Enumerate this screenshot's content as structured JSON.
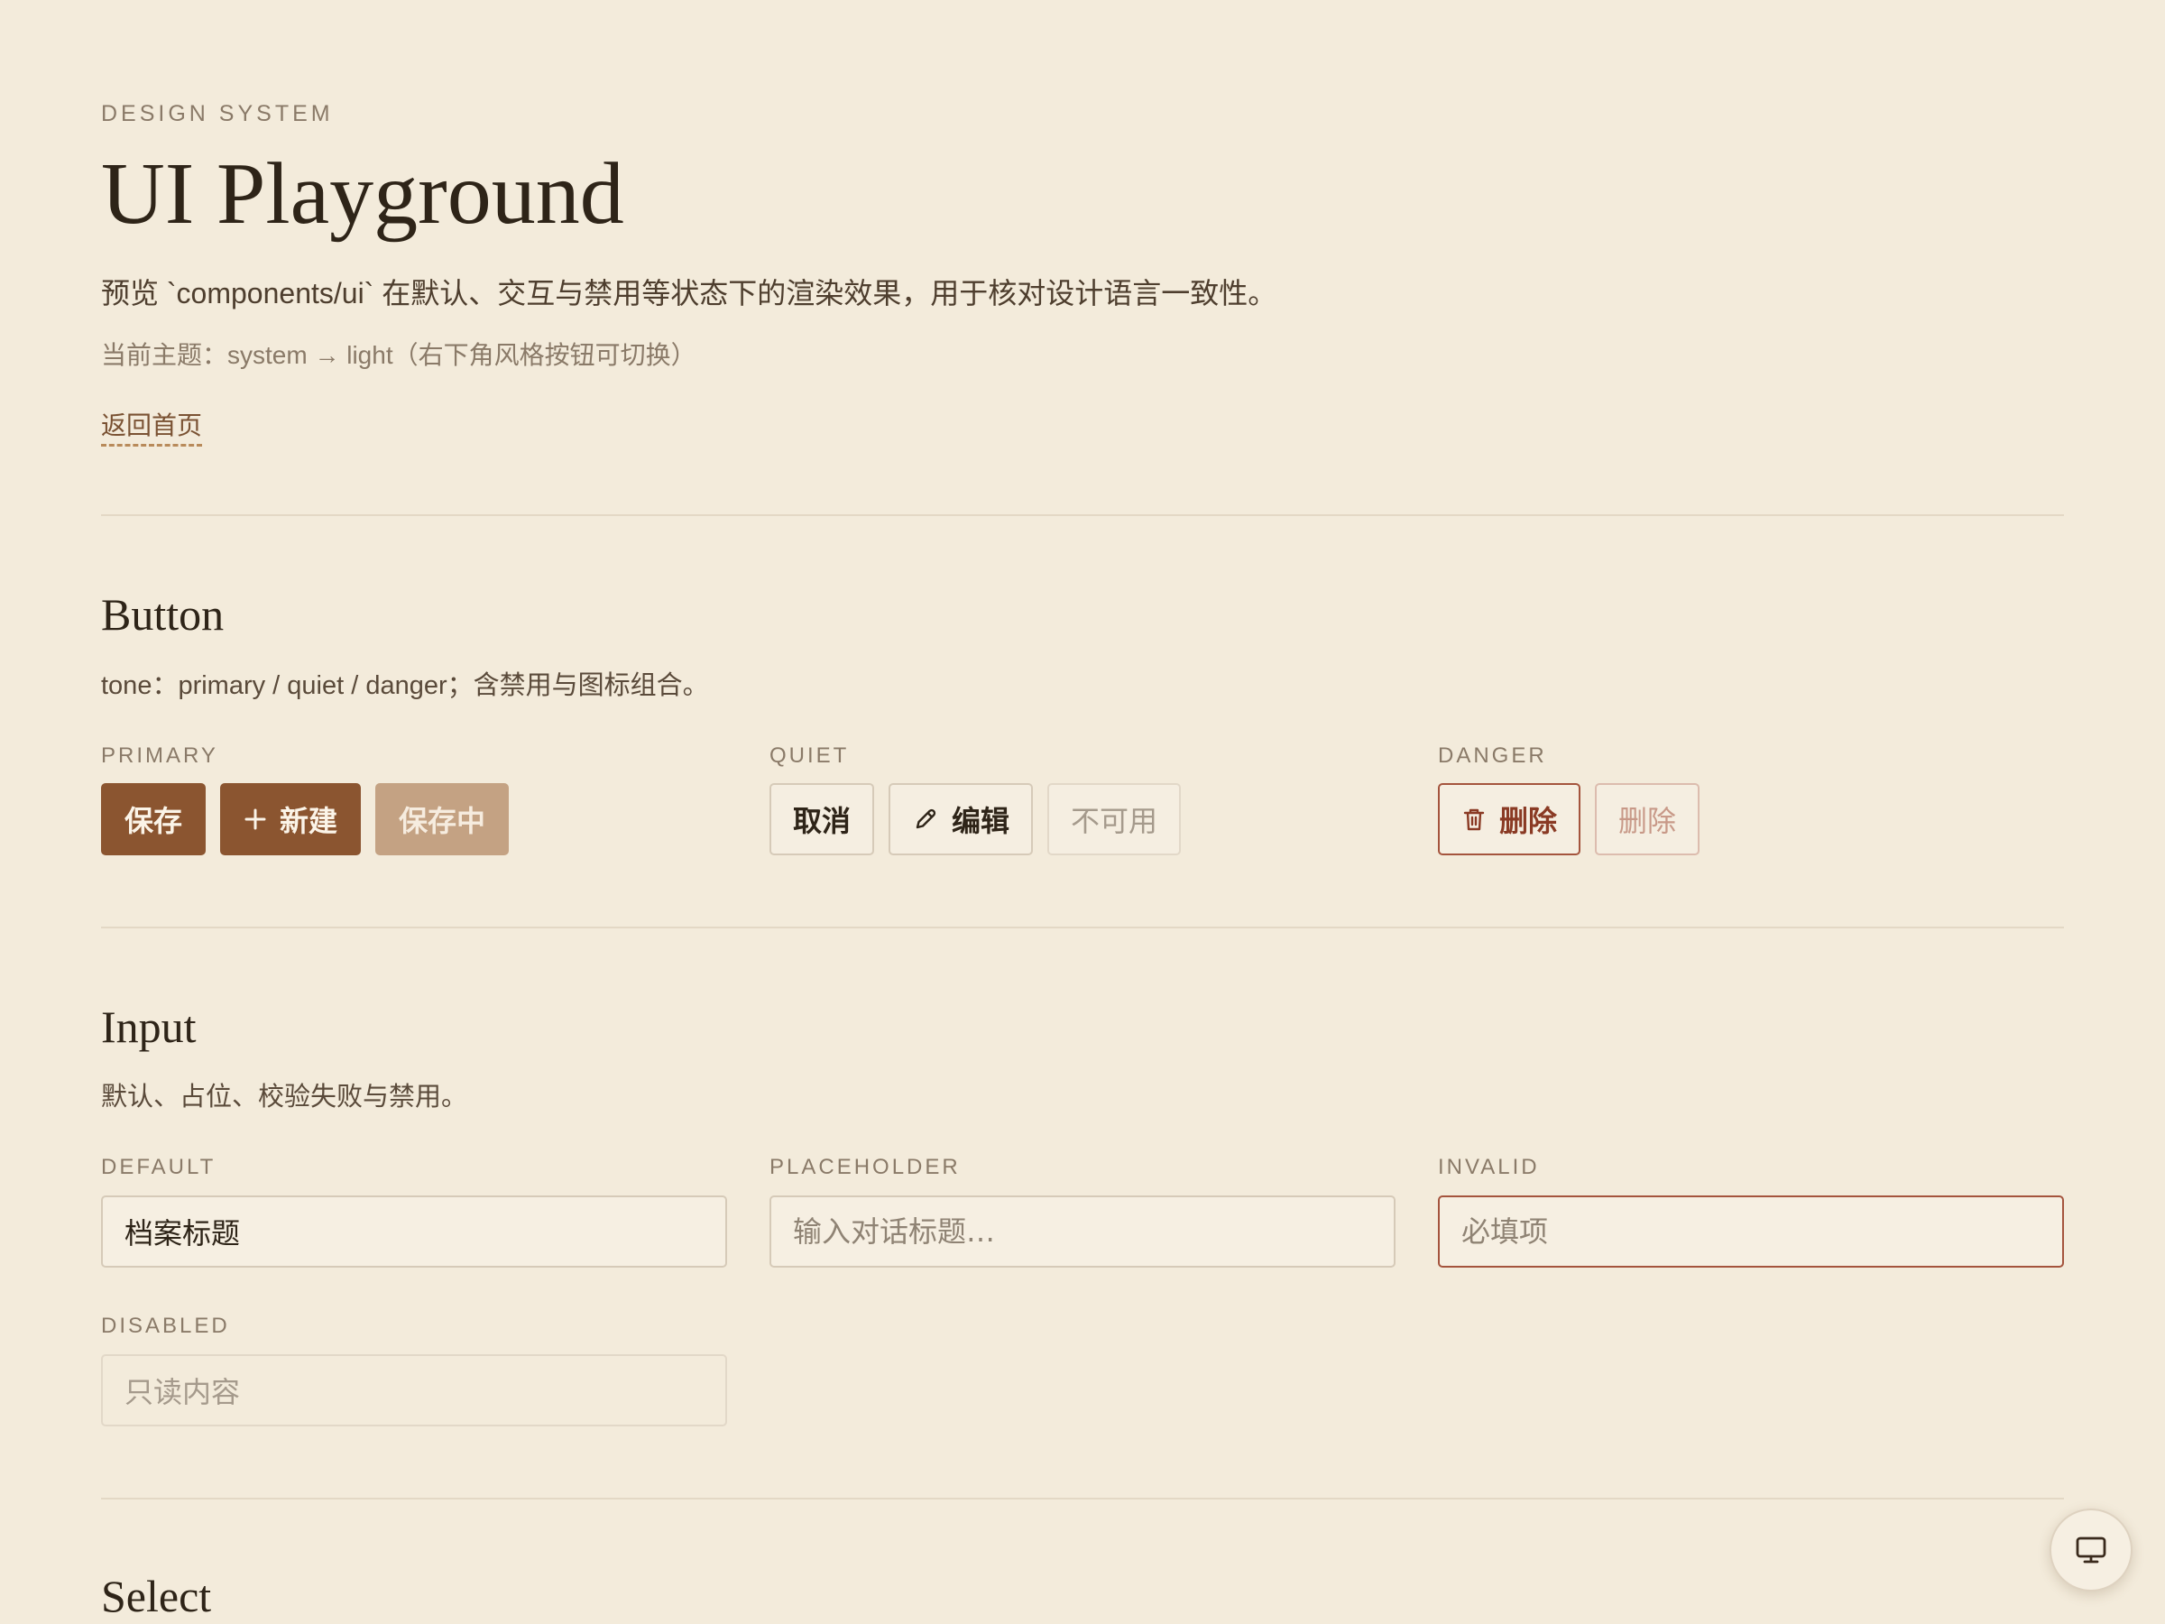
{
  "header": {
    "eyebrow": "DESIGN SYSTEM",
    "title": "UI Playground",
    "subtitle": "预览 `components/ui` 在默认、交互与禁用等状态下的渲染效果，用于核对设计语言一致性。",
    "theme_note": "当前主题：system → light（右下角风格按钮可切换）",
    "home_link": "返回首页"
  },
  "button_section": {
    "title": "Button",
    "description": "tone：primary / quiet / danger；含禁用与图标组合。",
    "primary": {
      "label": "PRIMARY",
      "save": "保存",
      "new": "新建",
      "saving": "保存中"
    },
    "quiet": {
      "label": "QUIET",
      "cancel": "取消",
      "edit": "编辑",
      "unavailable": "不可用"
    },
    "danger": {
      "label": "DANGER",
      "delete": "删除",
      "delete_disabled": "删除"
    }
  },
  "input_section": {
    "title": "Input",
    "description": "默认、占位、校验失败与禁用。",
    "default": {
      "label": "DEFAULT",
      "value": "档案标题"
    },
    "placeholder": {
      "label": "PLACEHOLDER",
      "placeholder": "输入对话标题…"
    },
    "invalid": {
      "label": "INVALID",
      "placeholder": "必填项"
    },
    "disabled": {
      "label": "DISABLED",
      "value": "只读内容"
    }
  },
  "select_section": {
    "title": "Select"
  },
  "icons": {
    "plus": "plus-icon",
    "pencil": "pencil-icon",
    "trash": "trash-icon",
    "monitor": "monitor-icon"
  },
  "colors": {
    "background": "#f3ebdb",
    "primary": "#8b5530",
    "primary_disabled": "#c4a283",
    "danger": "#a4543d",
    "text": "#2e2418",
    "muted": "#8a7a68"
  }
}
